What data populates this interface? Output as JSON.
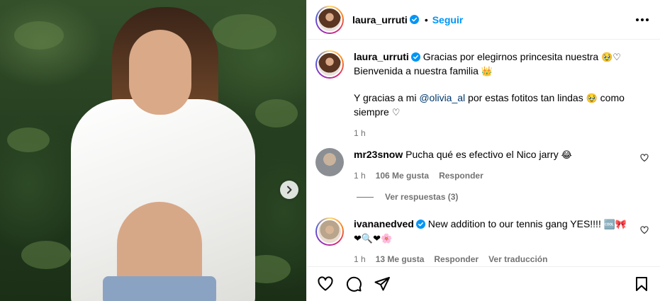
{
  "post": {
    "author": "laura_urruti",
    "follow_label": "Seguir",
    "separator": "•"
  },
  "photo": {
    "next_icon": "chevron-right-icon"
  },
  "caption": {
    "username": "laura_urruti",
    "line1": "Gracias por elegirnos princesita nuestra",
    "line1_emoji": "🥹♡",
    "line2": "Bienvenida a nuestra familia",
    "line2_emoji": "👑",
    "line3_pre": "Y gracias a mi",
    "line3_mention": "@olivia_al",
    "line3_post": "por estas fotitos tan lindas",
    "line3_emoji": "🥹",
    "line3_end": "como",
    "line4": "siempre",
    "line4_emoji": "♡",
    "time": "1 h"
  },
  "comments": [
    {
      "username": "mr23snow",
      "text": "Pucha qué es efectivo el Nico jarry",
      "emoji": "😂",
      "time": "1 h",
      "likes": "106 Me gusta",
      "reply_label": "Responder"
    },
    {
      "username": "ivananedved",
      "text": "New addition to our tennis gang YES!!!!",
      "emoji_line1": "🆒🎀",
      "emoji_line2": "❤🔍❤🌸",
      "time": "1 h",
      "likes": "13 Me gusta",
      "reply_label": "Responder",
      "translate_label": "Ver traducción"
    }
  ],
  "view_replies": "Ver respuestas (3)",
  "actions": {
    "like_icon": "heart-icon",
    "comment_icon": "comment-icon",
    "share_icon": "send-icon",
    "save_icon": "bookmark-icon"
  },
  "colors": {
    "accent": "#0095f6",
    "muted": "#737373",
    "mention": "#00376b",
    "verified": "#0095f6"
  }
}
